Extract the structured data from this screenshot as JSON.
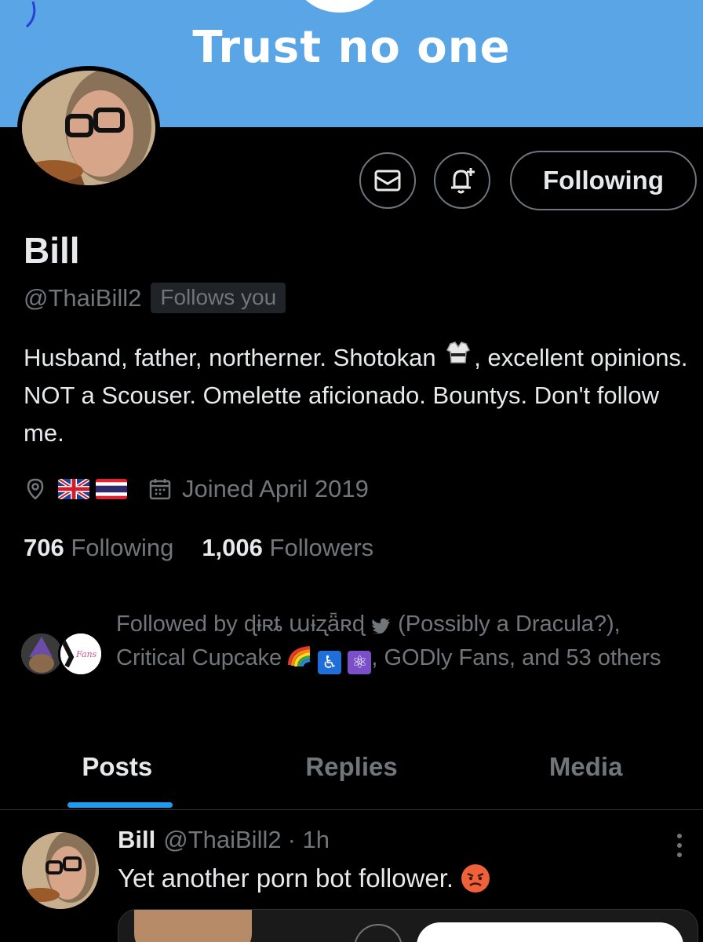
{
  "banner": {
    "title": "Trust no one"
  },
  "actions": {
    "message_icon": "envelope-icon",
    "notify_icon": "bell-plus-icon",
    "following_label": "Following"
  },
  "profile": {
    "name": "Bill",
    "handle": "@ThaiBill2",
    "follows_you": "Follows you",
    "bio_part1": "Husband, father, northerner. Shotokan",
    "bio_part2": ", excellent opinions. NOT a Scouser. Omelette aficionado. Bountys. Don't follow me.",
    "location_icon": "location-pin-icon",
    "location_flags": [
      "uk-flag",
      "thailand-flag"
    ],
    "joined": "Joined April 2019",
    "following_count": "706",
    "following_label": "Following",
    "followers_count": "1,006",
    "followers_label": "Followers"
  },
  "followed_by": {
    "prefix": "Followed by",
    "name1": "ɖɨʀȶ աɨʐǟʀɖ",
    "name1_suffix": "(Possibly a Dracula?),",
    "name2": "Critical Cupcake",
    "suffix": ", GODly Fans, and 53 others"
  },
  "tabs": [
    {
      "label": "Posts",
      "active": true
    },
    {
      "label": "Replies",
      "active": false
    },
    {
      "label": "Media",
      "active": false
    }
  ],
  "post": {
    "name": "Bill",
    "handle": "@ThaiBill2",
    "time": "· 1h",
    "text": "Yet another porn bot follower."
  },
  "colors": {
    "banner": "#5aa5e6",
    "accent": "#1d9bf0",
    "muted": "#71767b",
    "text": "#e7e9ea"
  }
}
